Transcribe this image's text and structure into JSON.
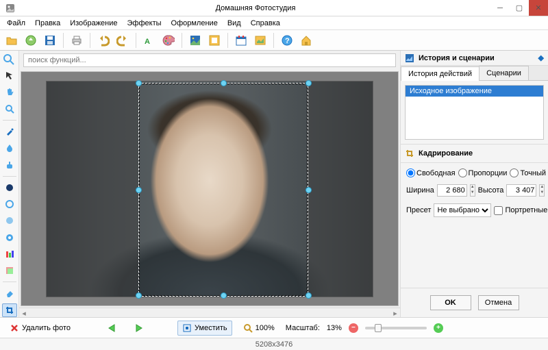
{
  "window": {
    "title": "Домашняя Фотостудия",
    "min": "—",
    "max": "☐",
    "close": "✕"
  },
  "menu": [
    "Файл",
    "Правка",
    "Изображение",
    "Эффекты",
    "Оформление",
    "Вид",
    "Справка"
  ],
  "search": {
    "placeholder": "поиск функций..."
  },
  "right": {
    "panel_title": "История и сценарии",
    "tabs": {
      "history": "История действий",
      "scenarios": "Сценарии"
    },
    "history_item": "Исходное изображение",
    "crop_section": "Кадрирование",
    "radios": {
      "free": "Свободная",
      "prop": "Пропорции",
      "exact": "Точный размер"
    },
    "width_label": "Ширина",
    "width_value": "2 680",
    "height_label": "Высота",
    "height_value": "3 407",
    "preset_label": "Пресет",
    "preset_value": "Не выбрано",
    "portrait_label": "Портретные",
    "ok": "OK",
    "cancel": "Отмена"
  },
  "bottom": {
    "delete_label": "Удалить фото",
    "fit_label": "Уместить",
    "hundred": "100%",
    "zoom_label": "Масштаб:",
    "zoom_value": "13%"
  },
  "status": {
    "dims": "5208x3476"
  },
  "icons": {
    "expand": "◆"
  }
}
